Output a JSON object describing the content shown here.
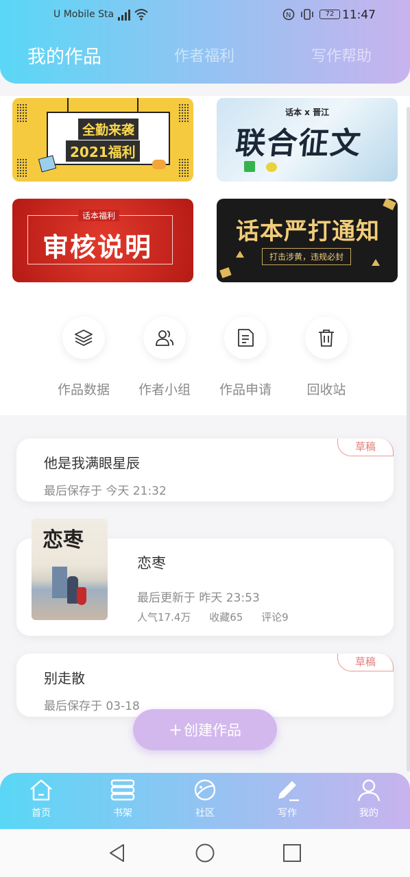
{
  "status_bar": {
    "carrier": "U Mobile Sta",
    "battery": "72",
    "time": "11:47"
  },
  "tabs": [
    {
      "label": "我的作品",
      "active": true
    },
    {
      "label": "作者福利",
      "active": false
    },
    {
      "label": "写作帮助",
      "active": false
    }
  ],
  "banners": [
    {
      "title": "全勤来袭",
      "subtitle": "2021福利"
    },
    {
      "title": "联合征文",
      "subtitle": "话本 x 晋江"
    },
    {
      "title": "审核说明",
      "subtitle": "话本福利"
    },
    {
      "title": "话本严打通知",
      "subtitle": "打击涉黄，违规必封"
    }
  ],
  "quick_actions": [
    {
      "label": "作品数据",
      "icon": "layers-icon"
    },
    {
      "label": "作者小组",
      "icon": "group-icon"
    },
    {
      "label": "作品申请",
      "icon": "document-icon"
    },
    {
      "label": "回收站",
      "icon": "trash-icon"
    }
  ],
  "works": [
    {
      "title": "他是我满眼星辰",
      "meta": "最后保存于 今天 21:32",
      "badge": "草稿"
    },
    {
      "title": "恋枣",
      "meta": "最后更新于 昨天 23:53",
      "stats": [
        "人气17.4万",
        "收藏65",
        "评论9"
      ],
      "cover_title": "恋枣"
    },
    {
      "title": "别走散",
      "meta": "最后保存于 03-18",
      "badge": "草稿"
    }
  ],
  "create_button": {
    "label": "创建作品"
  },
  "bottom_nav": [
    {
      "label": "首页",
      "icon": "home-icon"
    },
    {
      "label": "书架",
      "icon": "bookshelf-icon"
    },
    {
      "label": "社区",
      "icon": "planet-icon"
    },
    {
      "label": "写作",
      "icon": "pen-icon",
      "active": true
    },
    {
      "label": "我的",
      "icon": "profile-icon"
    }
  ]
}
